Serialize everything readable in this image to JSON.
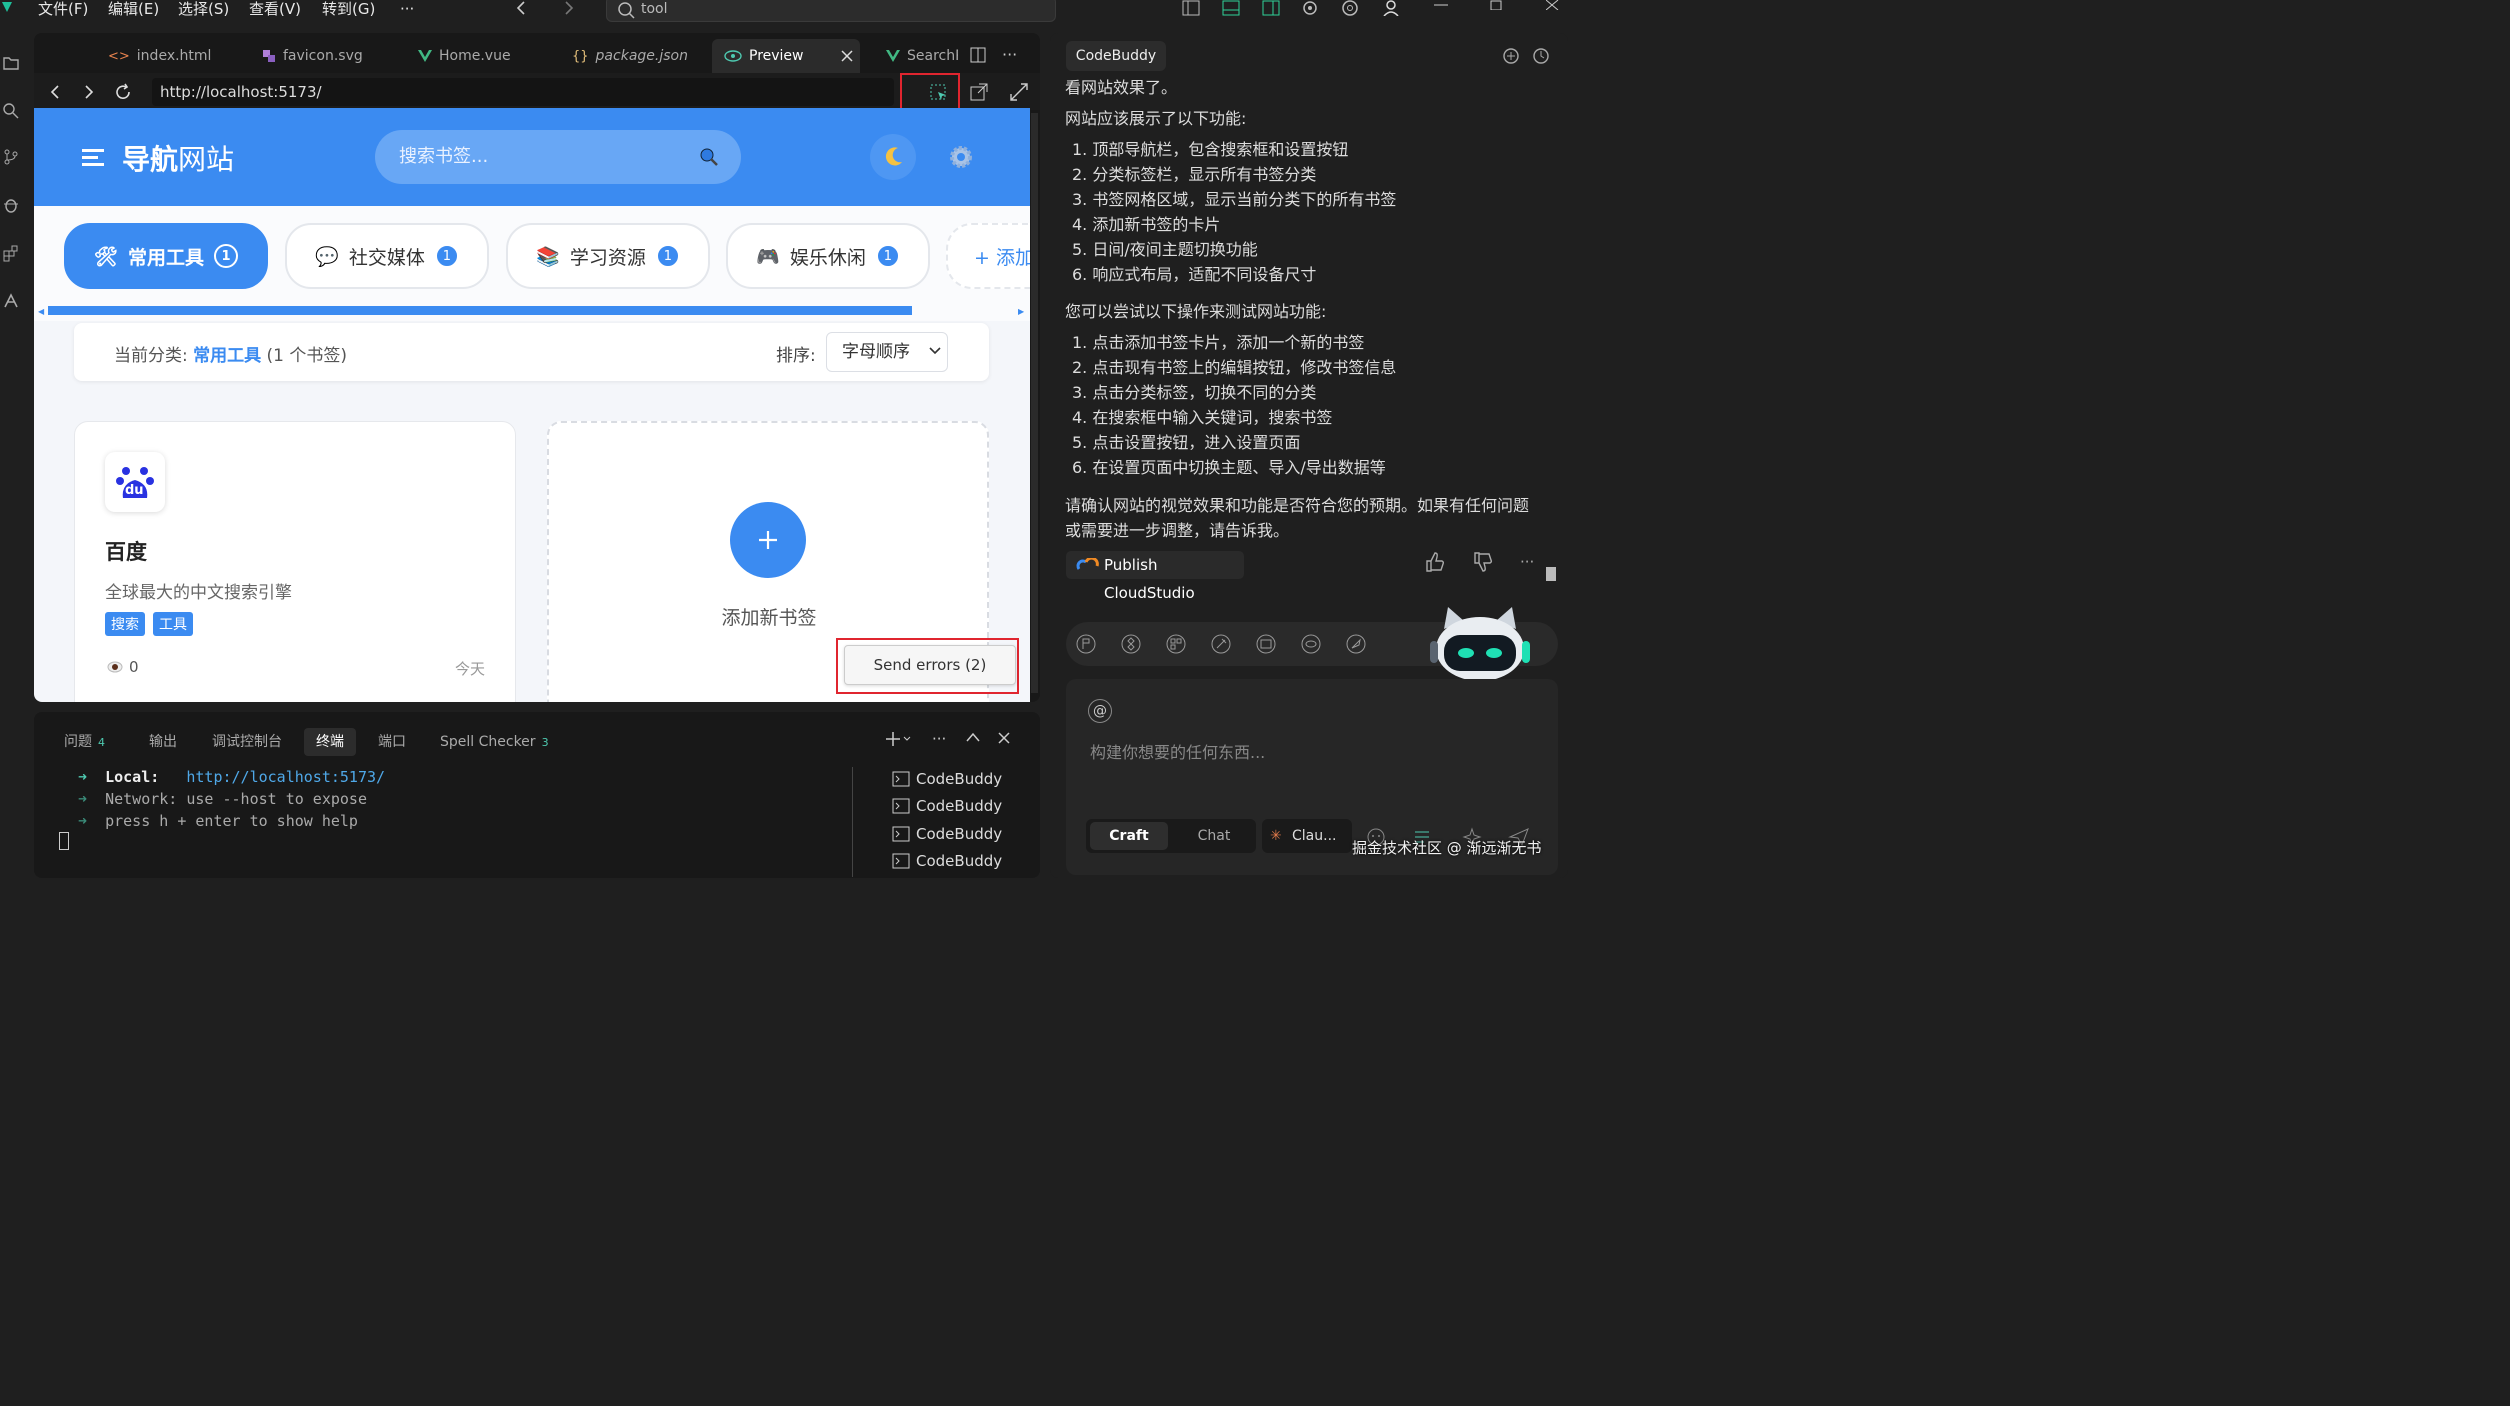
{
  "menubar": {
    "items": [
      "文件(F)",
      "编辑(E)",
      "选择(S)",
      "查看(V)",
      "转到(G)"
    ],
    "more": "···",
    "command_search": "tool"
  },
  "editor": {
    "tabs": [
      {
        "label": "index.html",
        "icon": "html-icon"
      },
      {
        "label": "favicon.svg",
        "icon": "svg-icon"
      },
      {
        "label": "Home.vue",
        "icon": "vue-icon"
      },
      {
        "label": "package.json",
        "icon": "json-icon"
      },
      {
        "label": "Preview",
        "icon": "eye-icon",
        "active": true
      },
      {
        "label": "SearchRe",
        "icon": "vue-icon"
      }
    ],
    "url": "http://localhost:5173/"
  },
  "web": {
    "brand_prefix": "导航",
    "brand_suffix": "网站",
    "search_placeholder": "搜索书签...",
    "categories": [
      {
        "label": "常用工具",
        "count": "1",
        "icon": "🛠",
        "active": true
      },
      {
        "label": "社交媒体",
        "count": "1",
        "icon": "💬"
      },
      {
        "label": "学习资源",
        "count": "1",
        "icon": "📚"
      },
      {
        "label": "娱乐休闲",
        "count": "1",
        "icon": "🎮"
      }
    ],
    "add_category": "+ 添加",
    "info": {
      "prefix": "当前分类: ",
      "category": "常用工具",
      "count_text": " (1 个书签)",
      "sort_label": "排序:",
      "sort_value": "字母顺序"
    },
    "bookmark": {
      "title": "百度",
      "logo_text": "du",
      "desc": "全球最大的中文搜索引擎",
      "tags": [
        "搜索",
        "工具"
      ],
      "views": "0",
      "date": "今天"
    },
    "add_card_label": "添加新书签",
    "send_errors": "Send errors (2)"
  },
  "panel": {
    "tabs": [
      {
        "label": "问题",
        "count": "4"
      },
      {
        "label": "输出",
        "count": ""
      },
      {
        "label": "调试控制台",
        "count": ""
      },
      {
        "label": "终端",
        "count": "",
        "active": true
      },
      {
        "label": "端口",
        "count": ""
      },
      {
        "label": "Spell Checker",
        "count": "3"
      }
    ],
    "terminal": {
      "local_label": "Local:",
      "local_url": "http://localhost:5173/",
      "network_line": "Network: use --host to expose",
      "help_line": "press h + enter to show help"
    },
    "terminals": [
      "CodeBuddy",
      "CodeBuddy",
      "CodeBuddy",
      "CodeBuddy"
    ]
  },
  "chat": {
    "tab": "CodeBuddy",
    "line0": "看网站效果了。",
    "heading1": "网站应该展示了以下功能:",
    "features": [
      "1. 顶部导航栏，包含搜索框和设置按钮",
      "2. 分类标签栏，显示所有书签分类",
      "3. 书签网格区域，显示当前分类下的所有书签",
      "4. 添加新书签的卡片",
      "5. 日间/夜间主题切换功能",
      "6. 响应式布局，适配不同设备尺寸"
    ],
    "heading2": "您可以尝试以下操作来测试网站功能:",
    "actions": [
      "1. 点击添加书签卡片，添加一个新的书签",
      "2. 点击现有书签上的编辑按钮，修改书签信息",
      "3. 点击分类标签，切换不同的分类",
      "4. 在搜索框中输入关键词，搜索书签",
      "5. 点击设置按钮，进入设置页面",
      "6. 在设置页面中切换主题、导入/导出数据等"
    ],
    "closing_1": "请确认网站的视觉效果和功能是否符合您的预期。如果有任何问题",
    "closing_2": "或需要进一步调整，请告诉我。",
    "publish": "Publish CloudStudio",
    "input_at": "@",
    "input_placeholder": "构建你想要的任何东西...",
    "modes": [
      "Craft",
      "Chat"
    ],
    "model": "Clau...",
    "watermark": "掘金技术社区 @ 渐远渐无书"
  },
  "colors": {
    "accent": "#3b8bf1",
    "highlight_red": "#e0252f"
  }
}
